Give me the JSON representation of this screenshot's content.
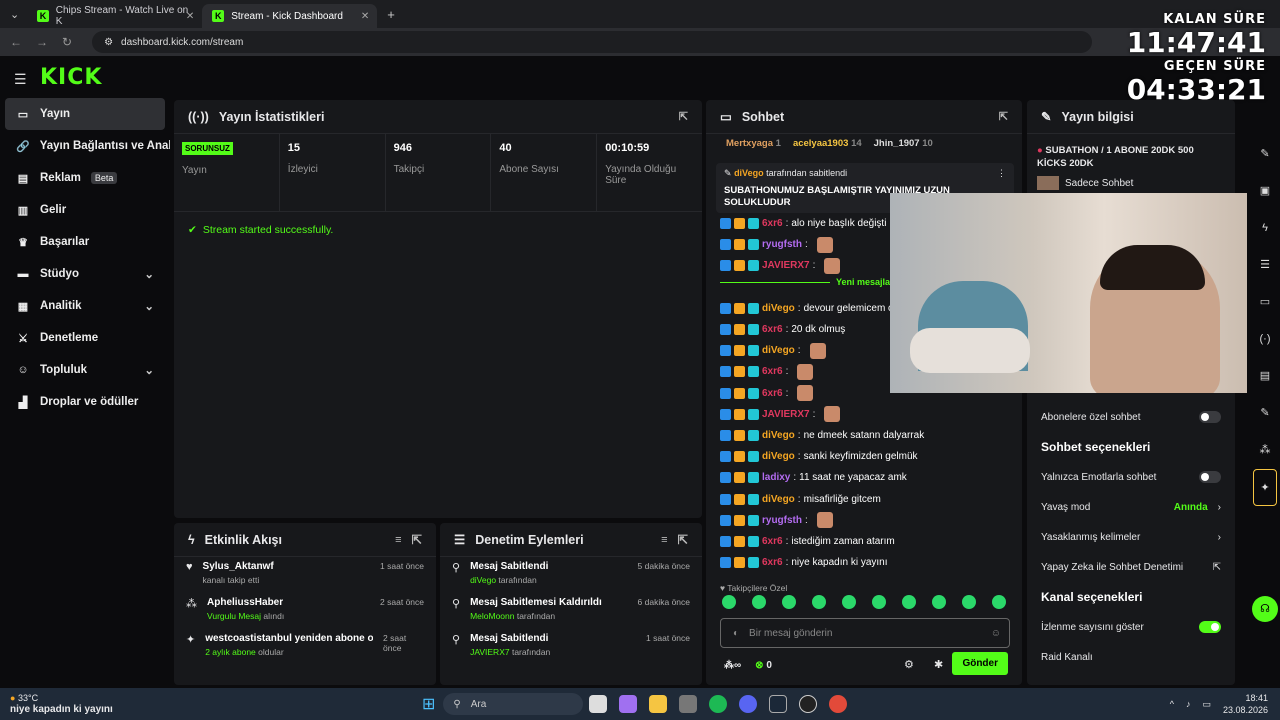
{
  "browser": {
    "tabs": [
      "Chips Stream - Watch Live on K",
      "Stream - Kick Dashboard"
    ],
    "url": "dashboard.kick.com/stream"
  },
  "logo": "KICK",
  "overlay": {
    "remaining_label": "KALAN SÜRE",
    "remaining": "11:47:41",
    "elapsed_label": "GEÇEN SÜRE",
    "elapsed": "04:33:21"
  },
  "sidebar": {
    "items": [
      {
        "label": "Yayın",
        "icon": "broadcast-icon"
      },
      {
        "label": "Yayın Bağlantısı ve Anahtarı",
        "icon": "link-icon"
      },
      {
        "label": "Reklam",
        "icon": "ad-icon",
        "badge": "Beta"
      },
      {
        "label": "Gelir",
        "icon": "chart-icon"
      },
      {
        "label": "Başarılar",
        "icon": "trophy-icon"
      },
      {
        "label": "Stüdyo",
        "icon": "studio-icon"
      },
      {
        "label": "Analitik",
        "icon": "analytics-icon"
      },
      {
        "label": "Denetleme",
        "icon": "sword-icon"
      },
      {
        "label": "Topluluk",
        "icon": "community-icon"
      },
      {
        "label": "Droplar ve ödüller",
        "icon": "drops-icon"
      }
    ]
  },
  "stats": {
    "title": "Yayın İstatistikleri",
    "status_badge": "SORUNSUZ",
    "status_label": "Yayın",
    "viewers": "15",
    "viewers_label": "İzleyici",
    "followers": "946",
    "followers_label": "Takipçi",
    "subs": "40",
    "subs_label": "Abone Sayısı",
    "uptime": "00:10:59",
    "uptime_label": "Yayında Olduğu Süre",
    "success": "Stream started successfully."
  },
  "activity": {
    "title": "Etkinlik Akışı",
    "rows": [
      {
        "name": "Sylus_Aktanwf",
        "sub": "kanalı takip etti",
        "time": "1 saat önce"
      },
      {
        "name": "ApheliussHaber",
        "sub_em": "Vurgulu Mesaj",
        "sub": " alındı",
        "time": "2 saat önce"
      },
      {
        "name": "westcoastistanbul yeniden abone oldu!",
        "sub_em": "2 aylık abone",
        "sub": " oldular",
        "time": "2 saat önce"
      }
    ]
  },
  "moderation": {
    "title": "Denetim Eylemleri",
    "rows": [
      {
        "name": "Mesaj Sabitlendi",
        "sub_em": "diVego",
        "sub": " tarafından",
        "time": "5 dakika önce"
      },
      {
        "name": "Mesaj Sabitlemesi Kaldırıldı",
        "sub_em": "MeloMoonn",
        "sub": " tarafından",
        "time": "6 dakika önce"
      },
      {
        "name": "Mesaj Sabitlendi",
        "sub_em": "JAVIERX7",
        "sub": " tarafından",
        "time": "1 saat önce"
      }
    ]
  },
  "chat": {
    "title": "Sohbet",
    "top": [
      {
        "name": "Mertxyaga",
        "count": "1"
      },
      {
        "name": "acelyaa1903",
        "count": "14"
      },
      {
        "name": "Jhin_1907",
        "count": "10"
      }
    ],
    "pinned_by": "diVego",
    "pinned_by_suffix": " tarafından sabitlendi",
    "pinned_text": "SUBATHONUMUZ BAŞLAMIŞTIR YAYINIMIZ UZUN SOLUKLUDUR",
    "new_messages": "Yeni mesajlar",
    "messages": [
      {
        "user": "6xr6",
        "color": "#e0385f",
        "text": "alo niye başlık değişti"
      },
      {
        "user": "ryugfsth",
        "color": "#b36cf0",
        "text": ""
      },
      {
        "user": "JAVIERX7",
        "color": "#e0385f",
        "text": ""
      },
      {
        "user": "",
        "color": "#53fc18",
        "text": ""
      },
      {
        "user": "diVego",
        "color": "#f5a623",
        "text": "devour gelemicem c"
      },
      {
        "user": "6xr6",
        "color": "#e0385f",
        "text": "20 dk olmuş"
      },
      {
        "user": "diVego",
        "color": "#f5a623",
        "text": ""
      },
      {
        "user": "6xr6",
        "color": "#e0385f",
        "text": ""
      },
      {
        "user": "6xr6",
        "color": "#e0385f",
        "text": ""
      },
      {
        "user": "JAVIERX7",
        "color": "#e0385f",
        "text": ""
      },
      {
        "user": "diVego",
        "color": "#f5a623",
        "text": "ne dmeek satann dalyarrak"
      },
      {
        "user": "diVego",
        "color": "#f5a623",
        "text": "sanki keyfimizden gelmük"
      },
      {
        "user": "ladixy",
        "color": "#b36cf0",
        "text": "11 saat ne yapacaz amk"
      },
      {
        "user": "diVego",
        "color": "#f5a623",
        "text": "misafirliğe gitcem"
      },
      {
        "user": "ryugfsth",
        "color": "#b36cf0",
        "text": ""
      },
      {
        "user": "6xr6",
        "color": "#e0385f",
        "text": "istediğim zaman atarım"
      },
      {
        "user": "6xr6",
        "color": "#e0385f",
        "text": "niye kapadın ki yayını"
      }
    ],
    "followers_only": "Takipçilere Özel",
    "placeholder": "Bir mesaj gönderin",
    "points": "0",
    "send": "Gönder"
  },
  "info": {
    "title": "Yayın bilgisi",
    "stream_title": "SUBATHON / 1 ABONE 20DK 500 KİCKS 20DK",
    "subtitle": "Sadece Sohbet",
    "subs_only": "Abonelere özel sohbet",
    "chat_options": "Sohbet seçenekleri",
    "emote_only": "Yalnızca Emotlarla sohbet",
    "slow_mode": "Yavaş mod",
    "slow_value": "Anında",
    "banned_words": "Yasaklanmış kelimeler",
    "ai_mod": "Yapay Zeka ile Sohbet Denetimi",
    "channel_options": "Kanal seçenekleri",
    "show_viewers": "İzlenme sayısını göster",
    "raid": "Raid Kanalı"
  },
  "taskbar": {
    "weather": "33°C",
    "ticker": "niye kapadın ki yayını",
    "search": "Ara",
    "time": "18:41",
    "date": "23.08.2026"
  }
}
